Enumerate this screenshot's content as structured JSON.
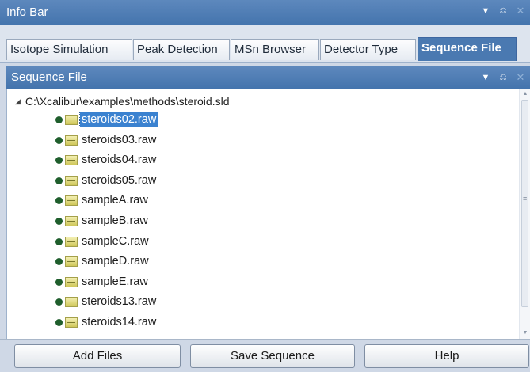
{
  "window": {
    "title": "Info Bar"
  },
  "tabs": [
    {
      "label": "Isotope Simulation"
    },
    {
      "label": "Peak Detection"
    },
    {
      "label": "MSn Browser"
    },
    {
      "label": "Detector Type"
    },
    {
      "label": "Sequence File",
      "active": true
    }
  ],
  "panel": {
    "title": "Sequence File"
  },
  "tree": {
    "root": "C:\\Xcalibur\\examples\\methods\\steroid.sld",
    "files": [
      {
        "name": "steroids02.raw",
        "selected": true
      },
      {
        "name": "steroids03.raw"
      },
      {
        "name": "steroids04.raw"
      },
      {
        "name": "steroids05.raw"
      },
      {
        "name": "sampleA.raw"
      },
      {
        "name": "sampleB.raw"
      },
      {
        "name": "sampleC.raw"
      },
      {
        "name": "sampleD.raw"
      },
      {
        "name": "sampleE.raw"
      },
      {
        "name": "steroids13.raw"
      },
      {
        "name": "steroids14.raw"
      }
    ]
  },
  "buttons": {
    "add_files": "Add Files",
    "save_sequence": "Save Sequence",
    "help": "Help"
  },
  "icons": {
    "dropdown": "chevron-down-icon",
    "pin": "pin-icon",
    "close": "close-icon",
    "file_status": "status-dot-icon",
    "raw_file": "raw-file-icon"
  },
  "colors": {
    "title_bar": "#4f7db5",
    "active_tab": "#4a79b1",
    "selection": "#3b82d0",
    "status_dot": "#1f5e2c"
  }
}
